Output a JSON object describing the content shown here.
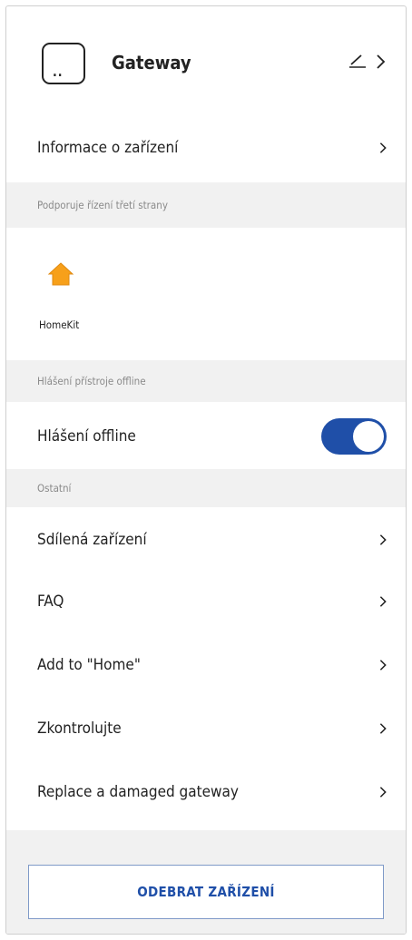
{
  "device": {
    "title": "Gateway",
    "icon_dots": ".."
  },
  "rows": {
    "info_label": "Informace o zařízení",
    "shared_label": "Sdílená zařízení",
    "faq_label": "FAQ",
    "add_home_label": "Add to \"Home\"",
    "check_label": "Zkontrolujte",
    "replace_label": "Replace a damaged gateway"
  },
  "sections": {
    "third_party": "Podporuje řízení třetí strany",
    "offline_report": "Hlášení přístroje offline",
    "other": "Ostatní"
  },
  "homekit": {
    "label": "HomeKit"
  },
  "offline_toggle": {
    "label": "Hlášení offline",
    "enabled": true
  },
  "remove_button": {
    "label": "ODEBRAT ZAŘÍZENÍ"
  },
  "colors": {
    "accent": "#1f4fa8",
    "section_bg": "#f1f1f1",
    "homekit_orange": "#f7a01a"
  }
}
